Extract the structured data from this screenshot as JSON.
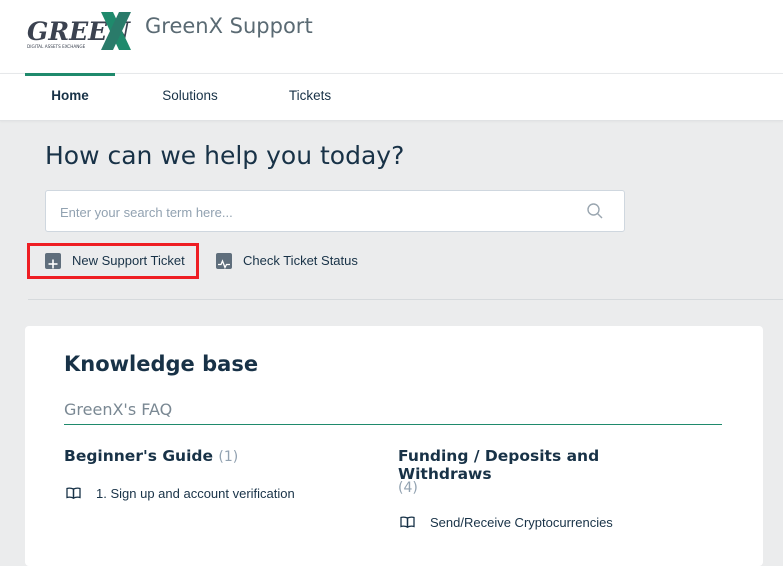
{
  "header": {
    "logo_text": "GREENX",
    "logo_tagline": "DIGITAL ASSETS EXCHANGE",
    "title": "GreenX Support"
  },
  "nav": {
    "tabs": [
      {
        "label": "Home",
        "active": true
      },
      {
        "label": "Solutions",
        "active": false
      },
      {
        "label": "Tickets",
        "active": false
      }
    ]
  },
  "hero": {
    "title": "How can we help you today?",
    "search_placeholder": "Enter your search term here...",
    "actions": {
      "new_ticket": "New Support Ticket",
      "check_status": "Check Ticket Status"
    }
  },
  "knowledge_base": {
    "title": "Knowledge base",
    "section": "GreenX's FAQ",
    "categories": [
      {
        "title": "Beginner's Guide",
        "count": "(1)",
        "articles": [
          "1. Sign up and account verification"
        ]
      },
      {
        "title": "Funding / Deposits and Withdraws",
        "count": "(4)",
        "articles": [
          "Send/Receive Cryptocurrencies"
        ]
      }
    ]
  },
  "colors": {
    "accent": "#1f8a6c",
    "highlight": "#ee1d23",
    "text": "#183247",
    "background": "#ebeced"
  }
}
